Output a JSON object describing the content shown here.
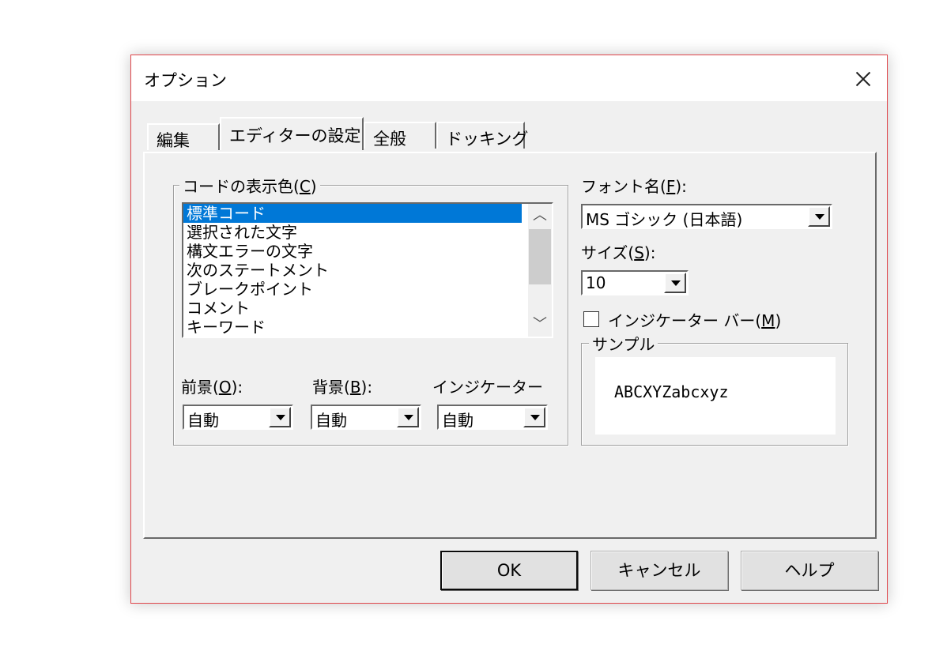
{
  "dialog": {
    "title": "オプション"
  },
  "tabs": [
    {
      "label": "編集"
    },
    {
      "label": "エディターの設定"
    },
    {
      "label": "全般"
    },
    {
      "label": "ドッキング"
    }
  ],
  "code_colors": {
    "group_label": "コードの表示色(",
    "group_key": "C",
    "group_close": ")",
    "items": [
      "標準コード",
      "選択された文字",
      "構文エラーの文字",
      "次のステートメント",
      "ブレークポイント",
      "コメント",
      "キーワード"
    ],
    "selected_index": 0,
    "foreground": {
      "label": "前景(",
      "key": "O",
      "close": "):",
      "value": "自動"
    },
    "background": {
      "label": "背景(",
      "key": "B",
      "close": "):",
      "value": "自動"
    },
    "indicator": {
      "label": "インジケーター",
      "value": "自動"
    }
  },
  "font": {
    "label": "フォント名(",
    "key": "F",
    "close": "):",
    "value": "MS ゴシック (日本語)"
  },
  "size": {
    "label": "サイズ(",
    "key": "S",
    "close": "):",
    "value": "10"
  },
  "indicator_bar": {
    "label": "インジケーター バー(",
    "key": "M",
    "close": ")",
    "checked": false
  },
  "sample": {
    "label": "サンプル",
    "text": "ABCXYZabcxyz"
  },
  "buttons": {
    "ok": "OK",
    "cancel": "キャンセル",
    "help": "ヘルプ"
  },
  "colors": {
    "selection": "#0078d7",
    "dialog_border": "#e0464b",
    "face": "#f0f0f0"
  }
}
